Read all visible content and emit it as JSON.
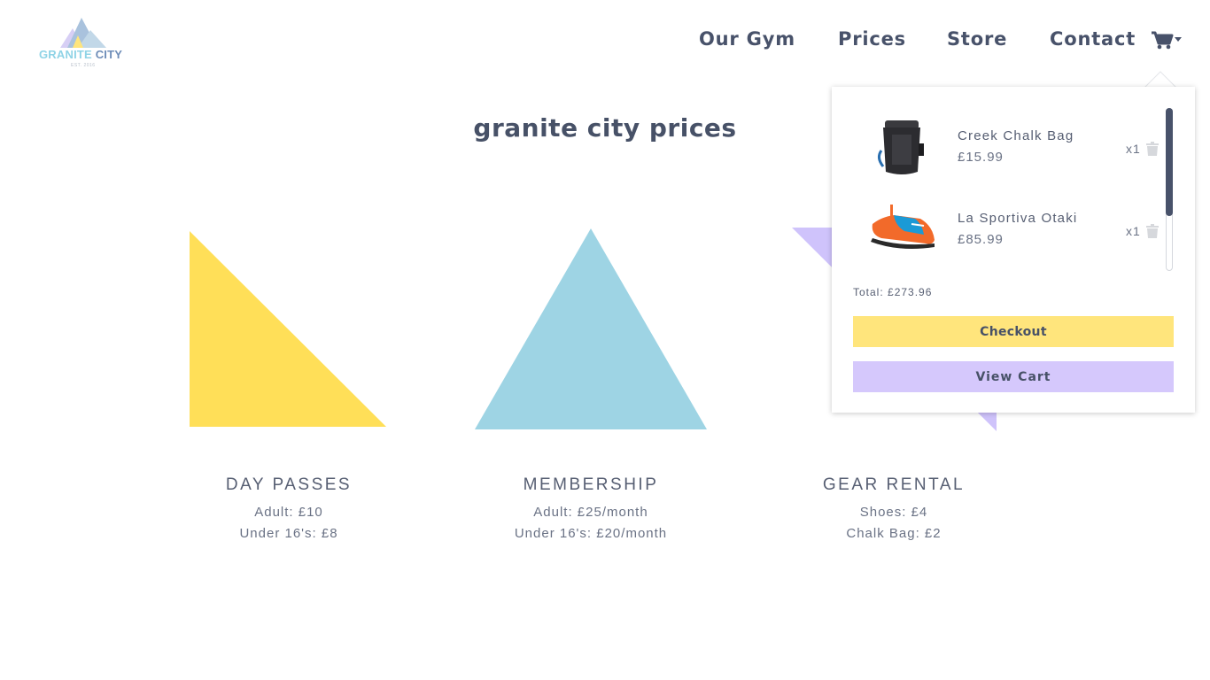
{
  "brand": {
    "name_part1": "GRANITE",
    "name_part2": "CITY",
    "est": "EST. 2016"
  },
  "nav": {
    "our_gym": "Our Gym",
    "prices": "Prices",
    "store": "Store",
    "contact": "Contact",
    "cart_icon": "shopping-cart-icon"
  },
  "page": {
    "title": "granite city prices"
  },
  "cards": [
    {
      "title": "DAY PASSES",
      "line1": "Adult: £10",
      "line2": "Under 16's: £8",
      "color": "#ffdf58"
    },
    {
      "title": "MEMBERSHIP",
      "line1": "Adult: £25/month",
      "line2": "Under 16's: £20/month",
      "color": "#9ed4e4"
    },
    {
      "title": "GEAR RENTAL",
      "line1": "Shoes: £4",
      "line2": "Chalk Bag: £2",
      "color": "#cfc3fb"
    }
  ],
  "cart": {
    "items": [
      {
        "name": "Creek Chalk Bag",
        "price": "£15.99",
        "qty": "x1"
      },
      {
        "name": "La Sportiva Otaki",
        "price": "£85.99",
        "qty": "x1"
      }
    ],
    "total": "Total: £273.96",
    "checkout_label": "Checkout",
    "view_cart_label": "View Cart"
  },
  "colors": {
    "text": "#475167",
    "yellow": "#ffdf58",
    "blue": "#9ed4e4",
    "purple": "#cfc3fb",
    "checkout": "#ffe57c",
    "view_cart": "#d5c8fc"
  }
}
